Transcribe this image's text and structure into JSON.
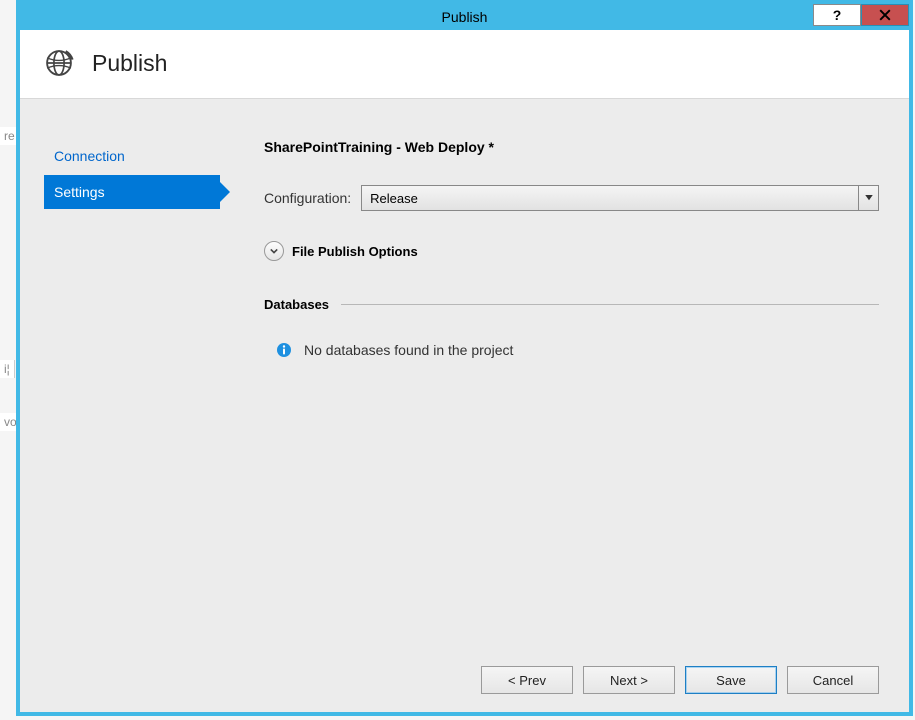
{
  "window": {
    "title": "Publish"
  },
  "header": {
    "title": "Publish"
  },
  "sidebar": {
    "items": [
      {
        "label": "Connection",
        "selected": false
      },
      {
        "label": "Settings",
        "selected": true
      }
    ]
  },
  "panel": {
    "profile_title": "SharePointTraining - Web Deploy *",
    "config_label": "Configuration:",
    "config_value": "Release",
    "file_publish_label": "File Publish Options",
    "databases_section": "Databases",
    "no_db_text": "No databases found in the project"
  },
  "buttons": {
    "prev": "< Prev",
    "next": "Next >",
    "save": "Save",
    "cancel": "Cancel"
  },
  "bg_hints": {
    "a": "re",
    "b": "i¦",
    "c": "vo"
  }
}
